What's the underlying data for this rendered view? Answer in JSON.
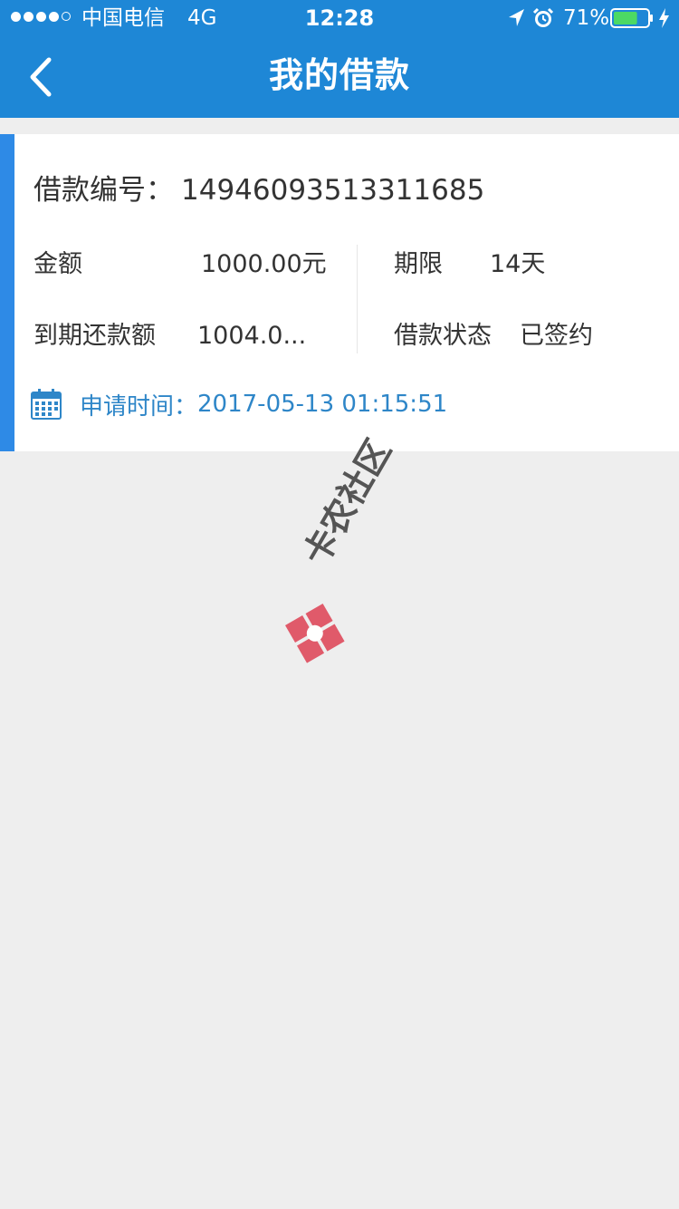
{
  "status_bar": {
    "carrier": "中国电信",
    "network": "4G",
    "time": "12:28",
    "battery_percent": "71%",
    "battery_level": 0.71,
    "icons": [
      "location-arrow-icon",
      "alarm-clock-icon",
      "battery-icon",
      "charging-bolt-icon"
    ]
  },
  "header": {
    "title": "我的借款",
    "back_icon": "chevron-left-icon",
    "background": "#1e87d6"
  },
  "loan": {
    "number_label": "借款编号：",
    "number_value": "14946093513311685",
    "amount_label": "金额",
    "amount_value": "1000.00元",
    "term_label": "期限",
    "term_value": "14天",
    "repay_label": "到期还款额",
    "repay_value": "1004.0...",
    "status_label": "借款状态",
    "status_value": "已签约",
    "apply_label": "申请时间：",
    "apply_value": "2017-05-13 01:15:51",
    "apply_icon": "calendar-icon",
    "accent_color": "#2e8ae6",
    "apply_color": "#2e86c8"
  },
  "watermark": {
    "text": "卡农社区",
    "icon": "kanong-logo-icon"
  }
}
